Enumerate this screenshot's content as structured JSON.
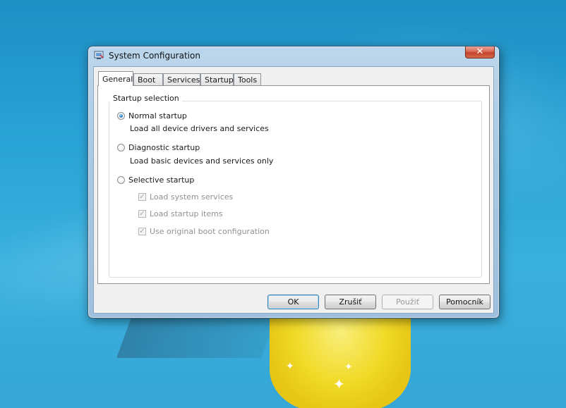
{
  "window": {
    "title": "System Configuration",
    "close_glyph": "✕"
  },
  "tabs": [
    {
      "label": "General",
      "active": true
    },
    {
      "label": "Boot",
      "active": false
    },
    {
      "label": "Services",
      "active": false
    },
    {
      "label": "Startup",
      "active": false
    },
    {
      "label": "Tools",
      "active": false
    }
  ],
  "startup_selection": {
    "legend": "Startup selection",
    "options": [
      {
        "label": "Normal startup",
        "description": "Load all device drivers and services",
        "selected": true
      },
      {
        "label": "Diagnostic startup",
        "description": "Load basic devices and services only",
        "selected": false
      },
      {
        "label": "Selective startup",
        "description": "",
        "selected": false
      }
    ],
    "selective_items": [
      {
        "label": "Load system services",
        "checked": true,
        "enabled": false
      },
      {
        "label": "Load startup items",
        "checked": true,
        "enabled": false
      },
      {
        "label": "Use original boot configuration",
        "checked": true,
        "enabled": false
      }
    ]
  },
  "buttons": {
    "ok": "OK",
    "cancel": "Zrušiť",
    "apply": "Použiť",
    "help": "Pomocník"
  },
  "icons": {
    "app": "msconfig-icon",
    "close": "close-icon",
    "check_glyph": "✓"
  },
  "colors": {
    "accent": "#3c7fb1",
    "close_red": "#c4422a",
    "desktop_blue": "#2aa3d6",
    "disabled_text": "#8d9196"
  }
}
